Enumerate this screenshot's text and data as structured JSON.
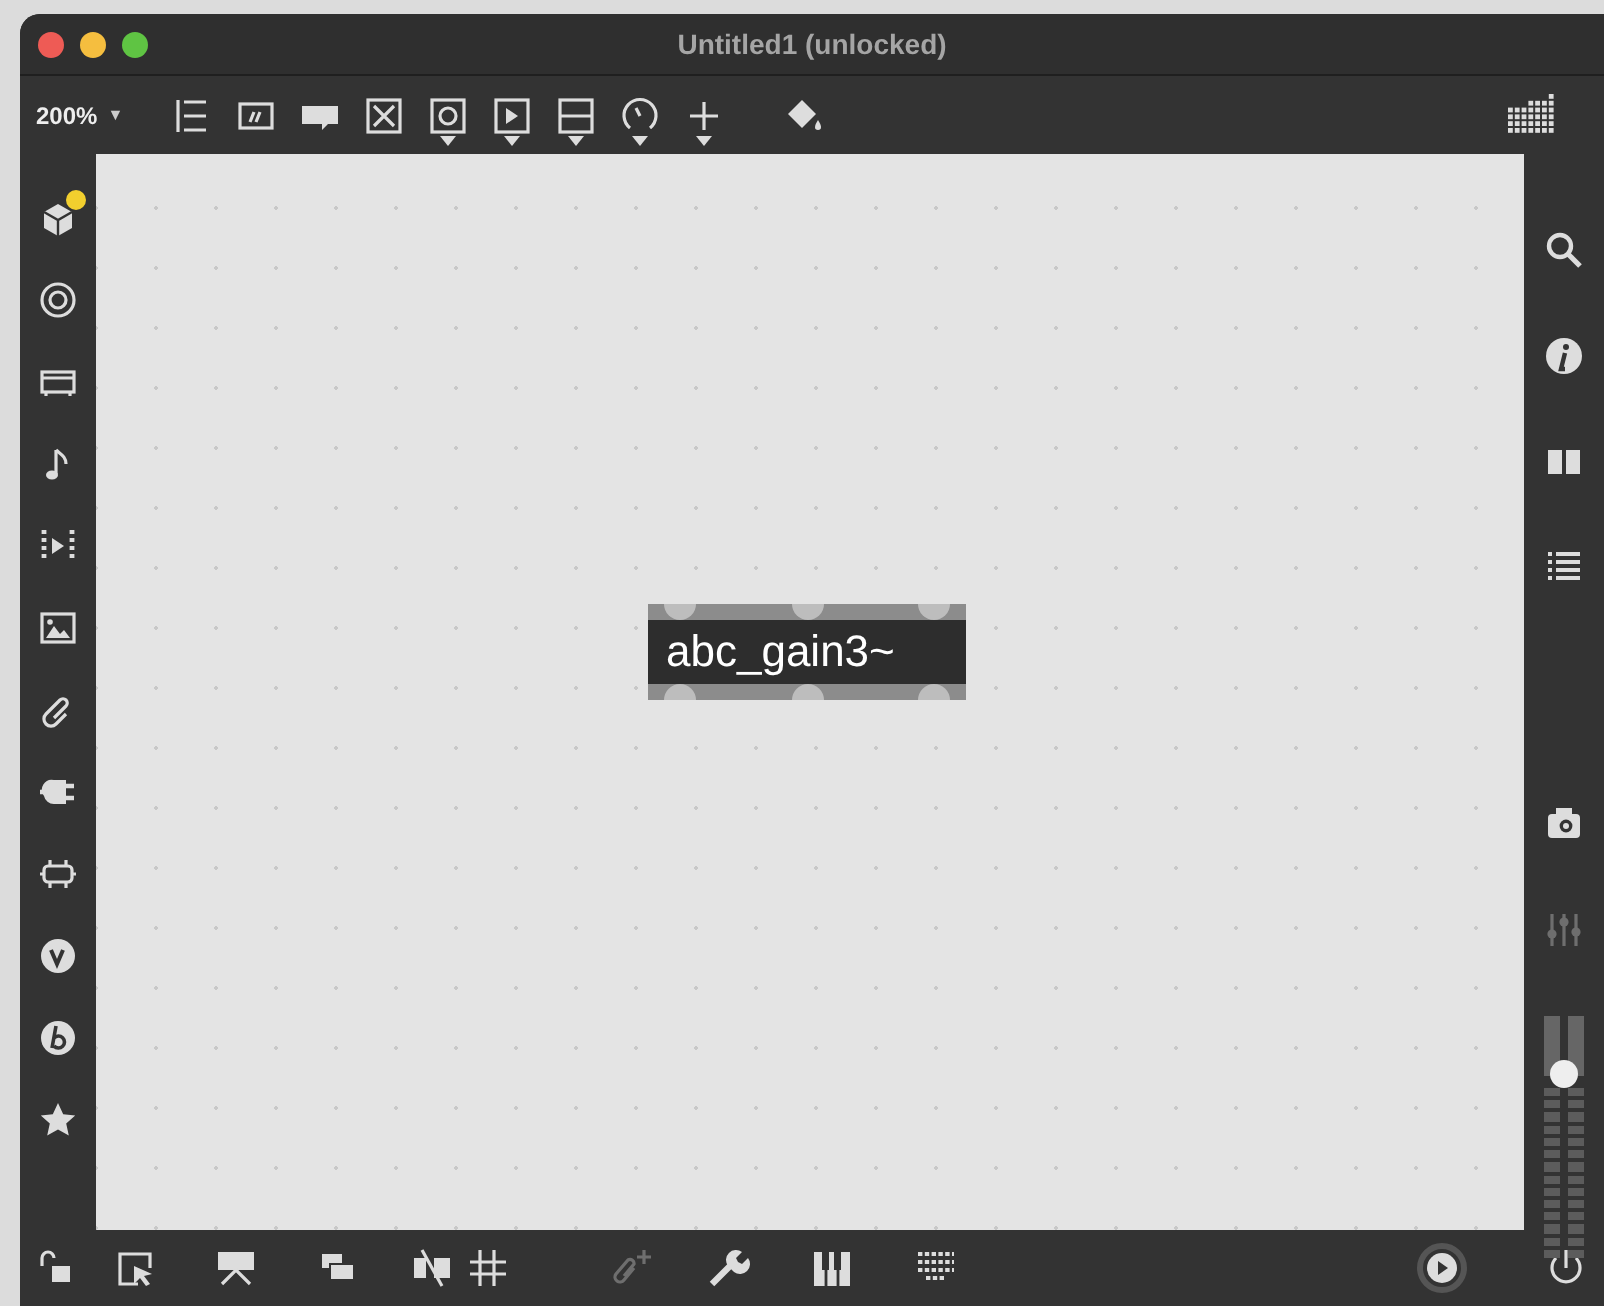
{
  "window": {
    "title": "Untitled1 (unlocked)"
  },
  "toolbar": {
    "zoom": "200%",
    "zoom_caret": "▼"
  },
  "left_sidebar": {
    "items": [
      {
        "badge": true
      },
      {
        "badge": false
      },
      {
        "badge": false
      },
      {
        "badge": false
      },
      {
        "badge": false
      },
      {
        "badge": false
      },
      {
        "badge": false
      },
      {
        "badge": false
      },
      {
        "badge": false
      },
      {
        "badge": false
      },
      {
        "badge": false
      },
      {
        "badge": false
      }
    ]
  },
  "canvas": {
    "objects": [
      {
        "kind": "object",
        "text": "abc_gain3~"
      }
    ]
  },
  "right_sidebar": {
    "items": [
      {
        "disabled": false
      },
      {
        "disabled": false
      },
      {
        "disabled": false
      },
      {
        "disabled": false
      },
      {
        "disabled": false
      },
      {
        "disabled": true
      }
    ],
    "volume": {
      "level": 0.76
    }
  },
  "bottom_bar": {
    "items": [
      {
        "disabled": false
      },
      {
        "disabled": false
      },
      {
        "disabled": false
      },
      {
        "disabled": false
      },
      {
        "disabled": false
      },
      {
        "disabled": false
      },
      {
        "disabled": true
      },
      {
        "disabled": false
      },
      {
        "disabled": false
      },
      {
        "disabled": false
      },
      {
        "disabled": false
      },
      {
        "disabled": false
      }
    ]
  }
}
